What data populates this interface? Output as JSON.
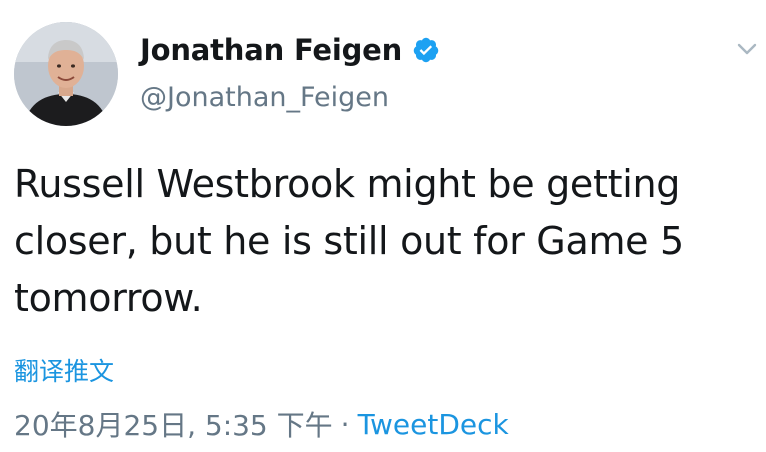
{
  "tweet": {
    "author": {
      "display_name": "Jonathan Feigen",
      "handle": "@Jonathan_Feigen",
      "verified": true,
      "avatar_icon": "user-avatar"
    },
    "text": "Russell Westbrook might be getting closer, but he is still out for Game 5 tomorrow.",
    "translate_label": "翻译推文",
    "timestamp": "20年8月25日, 5:35 下午",
    "separator": "·",
    "source": "TweetDeck"
  },
  "colors": {
    "link": "#1b95e0",
    "secondary": "#657786",
    "primary_text": "#14171a",
    "verified_badge": "#1da1f2"
  },
  "icons": {
    "verified": "verified-badge-icon",
    "menu": "chevron-down-icon"
  }
}
